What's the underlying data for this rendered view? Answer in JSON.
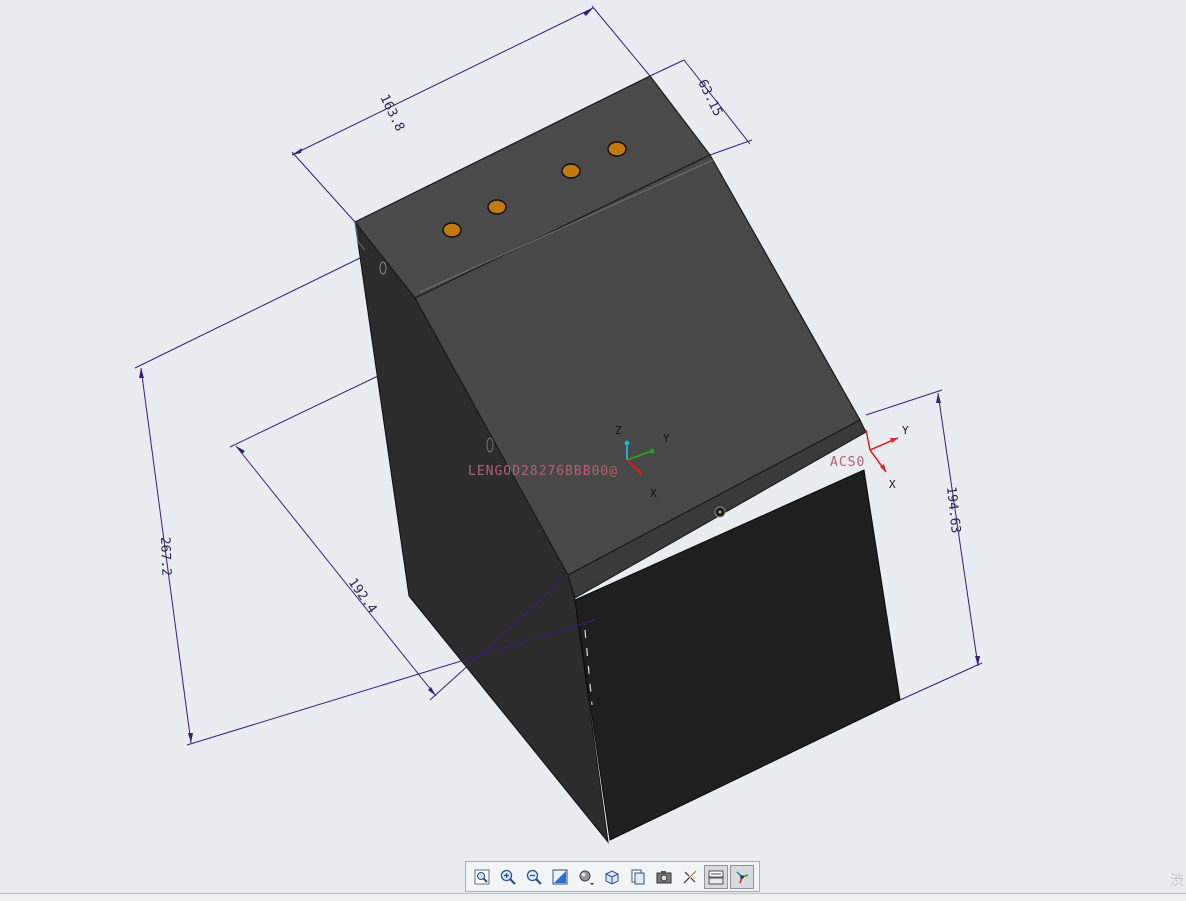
{
  "dimensions": {
    "top_width": "163.8",
    "top_depth": "63.15",
    "left_height": "267.2",
    "slope_length": "192.4",
    "front_height": "194.63"
  },
  "coordinate_systems": {
    "center": {
      "z": "Z",
      "y": "Y",
      "x": "X"
    },
    "acs": {
      "name": "ACS0",
      "y": "Y",
      "x": "X"
    }
  },
  "datum_label": "LENGOD28276BBB00@",
  "toolbar": {
    "buttons": [
      {
        "name": "refit-button",
        "icon": "refit-icon"
      },
      {
        "name": "zoom-in-button",
        "icon": "zoom-in-icon"
      },
      {
        "name": "zoom-out-button",
        "icon": "zoom-out-icon"
      },
      {
        "name": "repaint-button",
        "icon": "repaint-icon"
      },
      {
        "name": "display-style-button",
        "icon": "display-style-icon"
      },
      {
        "name": "saved-orientations-button",
        "icon": "view-cube-icon"
      },
      {
        "name": "view-manager-button",
        "icon": "view-manager-icon"
      },
      {
        "name": "perspective-button",
        "icon": "camera-icon"
      },
      {
        "name": "annotation-display-button",
        "icon": "annotation-icon"
      },
      {
        "name": "datum-display-button",
        "icon": "datum-filter-icon"
      },
      {
        "name": "spin-center-button",
        "icon": "spin-center-icon"
      }
    ]
  },
  "corner_text": "渋",
  "colors": {
    "background": "#e9ecf1",
    "model_top": "#474747",
    "model_front": "#202020",
    "model_side": "#2b2b2b",
    "hole_fill": "#c07a10",
    "dimension_line": "#3a1f7a",
    "acs_red": "#e02020"
  }
}
